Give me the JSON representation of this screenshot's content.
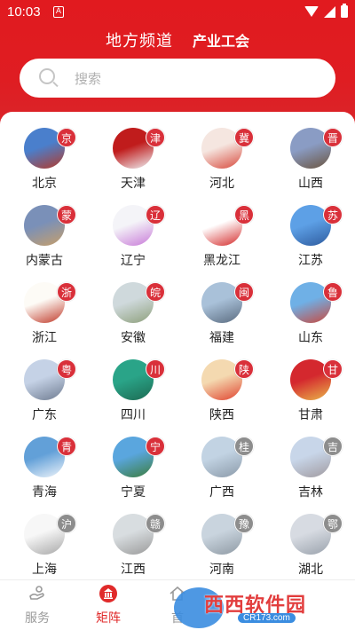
{
  "status_bar": {
    "time": "10:03",
    "app_indicator": "A"
  },
  "header": {
    "title": "地方频道",
    "subtitle": "产业工会"
  },
  "search": {
    "placeholder": "搜索"
  },
  "regions": [
    {
      "name": "北京",
      "badge": "京",
      "badge_color": "red",
      "colors": [
        "#4a7fcc",
        "#b33a2a"
      ]
    },
    {
      "name": "天津",
      "badge": "津",
      "badge_color": "red",
      "colors": [
        "#c01c1c",
        "#eef0f3"
      ]
    },
    {
      "name": "河北",
      "badge": "冀",
      "badge_color": "red",
      "colors": [
        "#f5e6e0",
        "#d84a3d"
      ]
    },
    {
      "name": "山西",
      "badge": "晋",
      "badge_color": "red",
      "colors": [
        "#8a9cc4",
        "#6b5540"
      ]
    },
    {
      "name": "内蒙古",
      "badge": "蒙",
      "badge_color": "red",
      "colors": [
        "#7a90b8",
        "#c79f6a"
      ]
    },
    {
      "name": "辽宁",
      "badge": "辽",
      "badge_color": "red",
      "colors": [
        "#f4f4f8",
        "#c87ad8"
      ]
    },
    {
      "name": "黑龙江",
      "badge": "黑",
      "badge_color": "red",
      "colors": [
        "#ffffff",
        "#d42a2a"
      ]
    },
    {
      "name": "江苏",
      "badge": "苏",
      "badge_color": "red",
      "colors": [
        "#5da0e6",
        "#2e5b9e"
      ]
    },
    {
      "name": "浙江",
      "badge": "浙",
      "badge_color": "red",
      "colors": [
        "#fdfbf6",
        "#c03a2a"
      ]
    },
    {
      "name": "安徽",
      "badge": "皖",
      "badge_color": "red",
      "colors": [
        "#cfd9dc",
        "#8ea07c"
      ]
    },
    {
      "name": "福建",
      "badge": "闽",
      "badge_color": "red",
      "colors": [
        "#a9c1d9",
        "#5b6c80"
      ]
    },
    {
      "name": "山东",
      "badge": "鲁",
      "badge_color": "red",
      "colors": [
        "#6fb0e6",
        "#c9493e"
      ]
    },
    {
      "name": "广东",
      "badge": "粤",
      "badge_color": "red",
      "colors": [
        "#c5d2e6",
        "#6f7c91"
      ]
    },
    {
      "name": "四川",
      "badge": "川",
      "badge_color": "red",
      "colors": [
        "#2aa488",
        "#1c6a52"
      ]
    },
    {
      "name": "陕西",
      "badge": "陕",
      "badge_color": "red",
      "colors": [
        "#f4d9b0",
        "#e0432f"
      ]
    },
    {
      "name": "甘肃",
      "badge": "甘",
      "badge_color": "red",
      "colors": [
        "#d4282e",
        "#e9b64a"
      ]
    },
    {
      "name": "青海",
      "badge": "青",
      "badge_color": "red",
      "colors": [
        "#62a0d8",
        "#eef4fa"
      ]
    },
    {
      "name": "宁夏",
      "badge": "宁",
      "badge_color": "red",
      "colors": [
        "#5aa6de",
        "#3c7d3e"
      ]
    },
    {
      "name": "广西",
      "badge": "桂",
      "badge_color": "gray",
      "colors": [
        "#c2d3e3",
        "#8b9aa9"
      ]
    },
    {
      "name": "吉林",
      "badge": "吉",
      "badge_color": "gray",
      "colors": [
        "#c8d6e9",
        "#a09aa0"
      ]
    },
    {
      "name": "上海",
      "badge": "沪",
      "badge_color": "gray",
      "colors": [
        "#f7f7f7",
        "#a8a8a8"
      ]
    },
    {
      "name": "江西",
      "badge": "赣",
      "badge_color": "gray",
      "colors": [
        "#d8dde0",
        "#9a9a9a"
      ]
    },
    {
      "name": "河南",
      "badge": "豫",
      "badge_color": "gray",
      "colors": [
        "#c9d4de",
        "#8f9aa4"
      ]
    },
    {
      "name": "湖北",
      "badge": "鄂",
      "badge_color": "gray",
      "colors": [
        "#d7dbe2",
        "#9aa2ac"
      ]
    }
  ],
  "bottom_nav": {
    "items": [
      {
        "label": "服务",
        "active": false
      },
      {
        "label": "矩阵",
        "active": true
      },
      {
        "label": "首",
        "active": false
      }
    ]
  },
  "watermark": {
    "text": "西西软件园",
    "url": "CR173.com"
  },
  "colors": {
    "primary": "#e11a1f",
    "badge_red": "#d9303a",
    "badge_gray": "#8d8d8d",
    "inactive_text": "#9a9a9a"
  }
}
